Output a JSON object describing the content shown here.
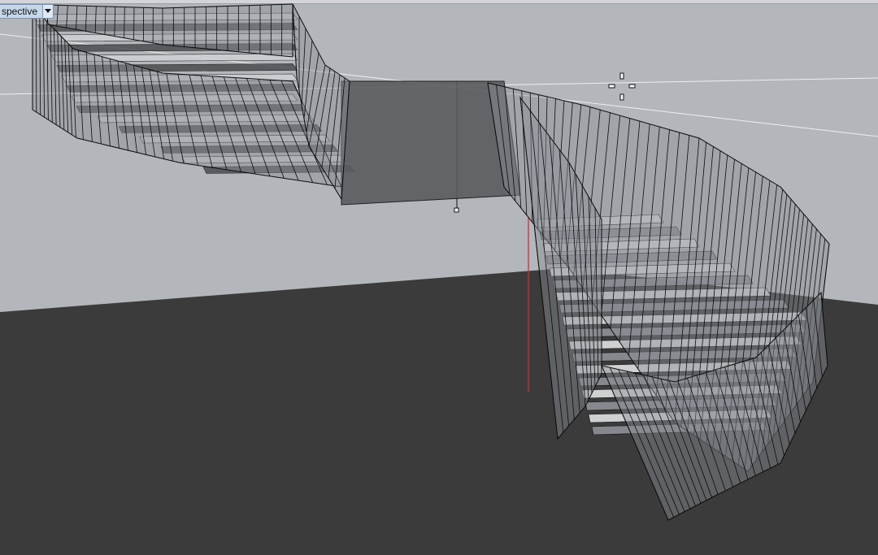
{
  "viewport": {
    "tab_label": "spective",
    "view_name": "Perspective",
    "dropdown_icon": "chevron-down-icon",
    "cursor_icon": "crosshair-icon",
    "colors": {
      "background": "#b3b6ba",
      "ground": "#3b3b3b",
      "railing_glass": "#8c9096",
      "stair_tread": "#d6d8da",
      "wire": "#0b0b0b",
      "world_axis_z": "#c83232"
    }
  }
}
